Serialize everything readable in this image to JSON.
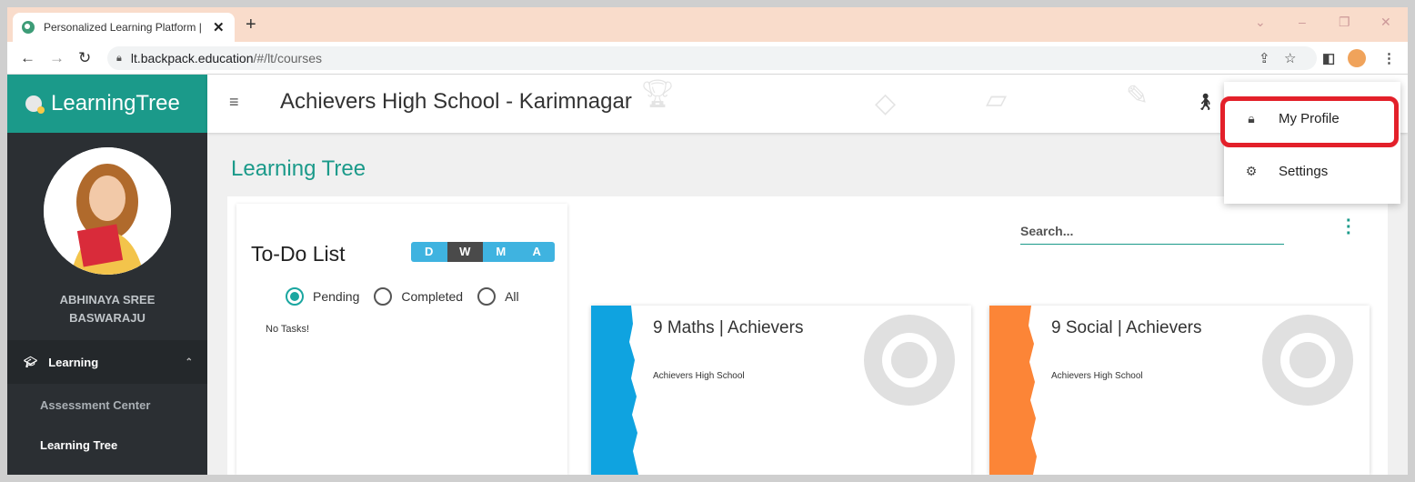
{
  "browser": {
    "tab_title": "Personalized Learning Platform |",
    "tab_close": "✕",
    "new_tab": "+",
    "url_host": "lt.backpack.education",
    "url_path": "/#/lt/courses"
  },
  "brand": {
    "name": "LearningTree",
    "color": "#1b9a8a"
  },
  "header": {
    "menu_icon": "≡",
    "school_name": "Achievers High School - Karimnagar"
  },
  "sidebar": {
    "user_name_line1": "ABHINAYA SREE",
    "user_name_line2": "BASWARAJU",
    "group_label": "Learning",
    "items": [
      {
        "label": "Assessment Center",
        "active": false
      },
      {
        "label": "Learning Tree",
        "active": true
      }
    ]
  },
  "main": {
    "title": "Learning Tree",
    "todo": {
      "title": "To-Do List",
      "periods": [
        "D",
        "W",
        "M",
        "A"
      ],
      "active_period": "W",
      "filters": [
        "Pending",
        "Completed",
        "All"
      ],
      "selected_filter": "Pending",
      "empty_text": "No Tasks!"
    },
    "search_placeholder": "Search...",
    "courses": [
      {
        "title": "9 Maths | Achievers",
        "school": "Achievers High School",
        "color": "#0fa3e0"
      },
      {
        "title": "9 Social | Achievers",
        "school": "Achievers High School",
        "color": "#fc8537"
      }
    ]
  },
  "dropdown": {
    "items": [
      {
        "label": "My Profile",
        "icon": "lock-icon"
      },
      {
        "label": "Settings",
        "icon": "gear-icon"
      }
    ],
    "highlight_color": "#e3202a"
  }
}
